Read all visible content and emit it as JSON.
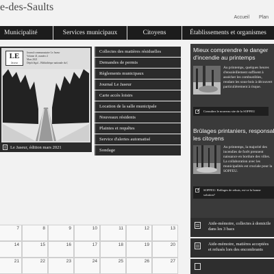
{
  "site": {
    "title": "e-des-Saults",
    "top_links": [
      "Accueil",
      "Plan"
    ]
  },
  "nav": [
    "Municipalité",
    "Services municipaux",
    "Citoyens",
    "Établissements et organismes"
  ],
  "journal": {
    "logo": "LE",
    "logo_sub": "Jaseur",
    "meta": [
      "Journal communautaire Le Jaseur",
      "Volume 41, numéro 2",
      "Mars 2021",
      "Dépôt légal – Bibliothèque nationale du Québec"
    ],
    "caption": "Le Jaseur, édition mars 2021"
  },
  "quick_links": [
    "Collectes des matières résiduelles",
    "Demandes de permis",
    "Règlements municipaux",
    "Journal Le Jaseur",
    "Carte accès loisirs",
    "Location de la salle municipale",
    "Nouveaux résidents",
    "Plaintes et requêtes",
    "Service d'alertes automatisé",
    "Sondage"
  ],
  "news": [
    {
      "title_lines": [
        "Mieux comprendre le danger",
        "d'incendie au printemps"
      ],
      "text": "Au printemps, quelques heures d'ensoleillement suffisent à assécher les combustibles, rendant les sous-bois à découvert particulièrement à risque.",
      "link": "Consultez le nouveau site de la SOPFEU"
    },
    {
      "title_lines": [
        "Brûlages printaniers, responsabilisons",
        "les citoyens"
      ],
      "text": "Au printemps, la majorité des incendies de forêt prennent naissance en bordure des villes. La collaboration avec les municipalités est cruciale pour la SOPFEU.",
      "link_lines": [
        "SOPFEU: Brûlages de rebuts, est-ce la bonne",
        "solution?"
      ]
    }
  ],
  "calendar": {
    "row1": [
      "7",
      "8",
      "9",
      "10",
      "11",
      "12",
      "13"
    ],
    "row2": [
      "14",
      "15",
      "16",
      "17",
      "18",
      "19",
      "20"
    ],
    "row3": [
      "21",
      "22",
      "23",
      "24",
      "25",
      "26",
      "27"
    ]
  },
  "side_items": [
    [
      "Aide-mémoire, collectes à domicile",
      "dans les 3 bacs"
    ],
    [
      "Aide-mémoire, matières acceptées",
      "et refusés lors des encombrants"
    ],
    [
      ""
    ]
  ]
}
